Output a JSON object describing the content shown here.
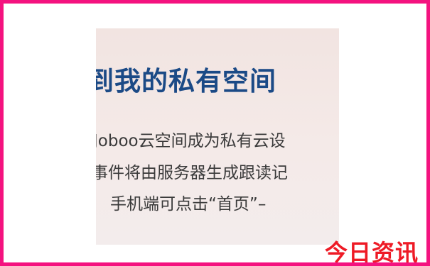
{
  "card": {
    "heading": "到我的私有空间",
    "lines": [
      "Joboo云空间成为私有云设",
      "事件将由服务器生成跟读记",
      "手机端可点击“首页”–"
    ]
  },
  "watermark": {
    "brand": "今日资讯"
  },
  "colors": {
    "border": "#f4127f",
    "heading": "#1b4a86",
    "brand": "#ee1a25",
    "card_background": "#f2e4e1"
  }
}
